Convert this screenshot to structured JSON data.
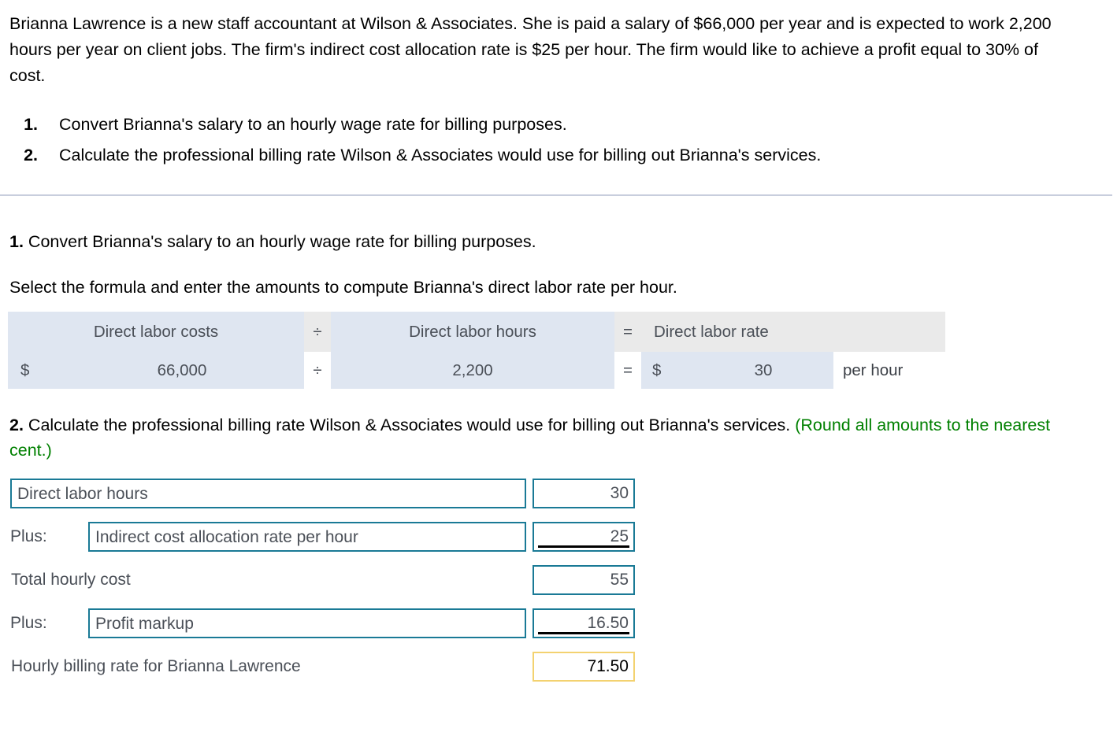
{
  "problem": {
    "statement": "Brianna Lawrence is a new staff accountant at Wilson & Associates. She is paid a salary of $66,000 per year and is expected to work 2,200 hours per year on client jobs. The firm's indirect cost allocation rate is $25 per hour. The firm would like to achieve a profit equal to 30% of cost.",
    "requirements": [
      {
        "number": "1.",
        "text": "Convert Brianna's salary to an hourly wage rate for billing purposes."
      },
      {
        "number": "2.",
        "text": "Calculate the professional billing rate Wilson & Associates would use for billing out Brianna's services."
      }
    ]
  },
  "requirement1": {
    "number": "1.",
    "heading": "Convert Brianna's salary to an hourly wage rate for billing purposes.",
    "prompt": "Select the formula and enter the amounts to compute Brianna's direct labor rate per hour.",
    "formula": {
      "header": {
        "term1": "Direct labor costs",
        "operator": "÷",
        "term2": "Direct labor hours",
        "equals": "=",
        "result": "Direct labor rate"
      },
      "values": {
        "term1_symbol": "$",
        "term1_amount": "66,000",
        "operator": "÷",
        "term2_amount": "2,200",
        "equals": "=",
        "result_symbol": "$",
        "result_amount": "30",
        "unit": "per hour"
      }
    }
  },
  "requirement2": {
    "number": "2.",
    "heading": "Calculate the professional billing rate Wilson & Associates would use for billing out Brianna's services.",
    "note": "(Round all amounts to the nearest cent.)",
    "note_color": "#008000",
    "rows": [
      {
        "prefix": "",
        "label": "Direct labor hours",
        "label_is_input": true,
        "value": "30",
        "value_style": "plain"
      },
      {
        "prefix": "Plus:",
        "label": "Indirect cost allocation rate per hour",
        "label_is_input": true,
        "value": "25",
        "value_style": "subtotal"
      },
      {
        "prefix": "",
        "label": "Total hourly cost",
        "label_is_input": false,
        "value": "55",
        "value_style": "plain"
      },
      {
        "prefix": "Plus:",
        "label": "Profit markup",
        "label_is_input": true,
        "value": "16.50",
        "value_style": "subtotal"
      },
      {
        "prefix": "",
        "label": "Hourly billing rate for Brianna Lawrence",
        "label_is_input": false,
        "value": "71.50",
        "value_style": "final"
      }
    ]
  },
  "colors": {
    "input_border": "#1a7a96",
    "final_border": "#f3d270",
    "formula_cell": "#dfe6f1",
    "formula_header_op": "#eaeaea",
    "divider": "#c8cedd",
    "note_green": "#008000"
  }
}
